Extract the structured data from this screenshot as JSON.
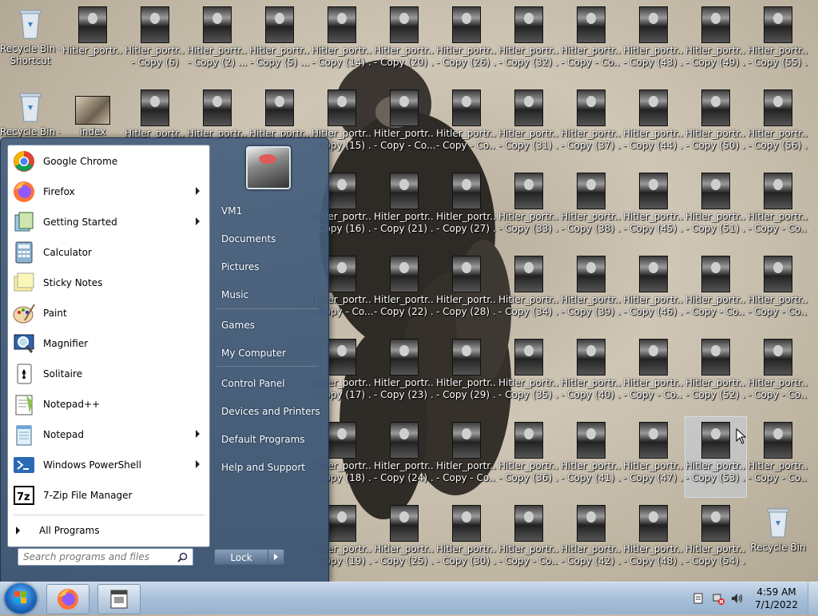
{
  "desktop": {
    "row1": [
      {
        "l1": "Recycle Bin -",
        "l2": "Shortcut",
        "kind": "bin"
      },
      {
        "l1": "Hitler_portr...",
        "l2": "",
        "kind": "photo"
      },
      {
        "l1": "Hitler_portr...",
        "l2": "- Copy (6)",
        "kind": "photo"
      },
      {
        "l1": "Hitler_portr...",
        "l2": "- Copy (2) ...",
        "kind": "photo"
      },
      {
        "l1": "Hitler_portr...",
        "l2": "- Copy (5) ...",
        "kind": "photo"
      },
      {
        "l1": "Hitler_portr...",
        "l2": "- Copy (14) ...",
        "kind": "photo"
      },
      {
        "l1": "Hitler_portr...",
        "l2": "- Copy (20) ...",
        "kind": "photo"
      },
      {
        "l1": "Hitler_portr...",
        "l2": "- Copy (26) ...",
        "kind": "photo"
      },
      {
        "l1": "Hitler_portr...",
        "l2": "- Copy (32) ...",
        "kind": "photo"
      },
      {
        "l1": "Hitler_portr...",
        "l2": "- Copy - Co...",
        "kind": "photo"
      },
      {
        "l1": "Hitler_portr...",
        "l2": "- Copy (43) ...",
        "kind": "photo"
      },
      {
        "l1": "Hitler_portr...",
        "l2": "- Copy (49) ...",
        "kind": "photo"
      },
      {
        "l1": "Hitler_portr...",
        "l2": "- Copy (55) ...",
        "kind": "photo"
      }
    ],
    "row2": [
      {
        "l1": "Recycle Bin -",
        "l2": "",
        "kind": "bin"
      },
      {
        "l1": "index",
        "l2": "",
        "kind": "monkey"
      },
      {
        "l1": "Hitler_portr...",
        "l2": "",
        "kind": "photo"
      },
      {
        "l1": "Hitler_portr...",
        "l2": "",
        "kind": "photo"
      },
      {
        "l1": "Hitler_portr...",
        "l2": "",
        "kind": "photo"
      },
      {
        "l1": "Hitler_portr...",
        "l2": "- Copy (15) ...",
        "kind": "photo"
      },
      {
        "l1": "Hitler_portr...",
        "l2": "- Copy - Co...",
        "kind": "photo"
      },
      {
        "l1": "Hitler_portr...",
        "l2": "- Copy - Co...",
        "kind": "photo"
      },
      {
        "l1": "Hitler_portr...",
        "l2": "- Copy (31) ...",
        "kind": "photo"
      },
      {
        "l1": "Hitler_portr...",
        "l2": "- Copy (37) ...",
        "kind": "photo"
      },
      {
        "l1": "Hitler_portr...",
        "l2": "- Copy (44) ...",
        "kind": "photo"
      },
      {
        "l1": "Hitler_portr...",
        "l2": "- Copy (50) ...",
        "kind": "photo"
      },
      {
        "l1": "Hitler_portr...",
        "l2": "- Copy (56) ...",
        "kind": "photo"
      }
    ],
    "grid": [
      [
        "- Copy (16) ...",
        "- Copy (21) ...",
        "- Copy (27) ...",
        "- Copy (33) ...",
        "- Copy (38) ...",
        "- Copy (45) ...",
        "- Copy (51) ...",
        "- Copy - Co..."
      ],
      [
        "- Copy - Co...",
        "- Copy (22) ...",
        "- Copy (28) ...",
        "- Copy (34) ...",
        "- Copy (39) ...",
        "- Copy (46) ...",
        "- Copy - Co...",
        "- Copy - Co..."
      ],
      [
        "- Copy (17) ...",
        "- Copy (23) ...",
        "- Copy (29) ...",
        "- Copy (35) ...",
        "- Copy (40) ...",
        "- Copy - Co...",
        "- Copy (52) ...",
        "- Copy - Co..."
      ],
      [
        "- Copy (18) ...",
        "- Copy (24) ...",
        "- Copy - Co...",
        "- Copy (36) ...",
        "- Copy (41) ...",
        "- Copy (47) ...",
        "- Copy (53) ...",
        "- Copy - Co..."
      ],
      [
        "- Copy (19) ...",
        "- Copy (25) ...",
        "- Copy (30) ...",
        "- Copy - Co...",
        "- Copy (42) ...",
        "- Copy (48) ...",
        "- Copy (54) ...",
        ""
      ]
    ],
    "grid_label": "Hitler_portr...",
    "recycle_bin_label": "Recycle Bin"
  },
  "start_menu": {
    "programs": [
      {
        "label": "Google Chrome",
        "icon": "chrome-icon",
        "submenu": false
      },
      {
        "label": "Firefox",
        "icon": "firefox-icon",
        "submenu": true
      },
      {
        "label": "Getting Started",
        "icon": "getting-started-icon",
        "submenu": true
      },
      {
        "label": "Calculator",
        "icon": "calculator-icon",
        "submenu": false
      },
      {
        "label": "Sticky Notes",
        "icon": "sticky-notes-icon",
        "submenu": false
      },
      {
        "label": "Paint",
        "icon": "paint-icon",
        "submenu": false
      },
      {
        "label": "Magnifier",
        "icon": "magnifier-icon",
        "submenu": false
      },
      {
        "label": "Solitaire",
        "icon": "solitaire-icon",
        "submenu": false
      },
      {
        "label": "Notepad++",
        "icon": "notepadpp-icon",
        "submenu": false
      },
      {
        "label": "Notepad",
        "icon": "notepad-icon",
        "submenu": true
      },
      {
        "label": "Windows PowerShell",
        "icon": "powershell-icon",
        "submenu": true
      },
      {
        "label": "7-Zip File Manager",
        "icon": "sevenzip-icon",
        "submenu": false
      }
    ],
    "all_programs": "All Programs",
    "search_placeholder": "Search programs and files",
    "right_items": [
      "VM1",
      "Documents",
      "Pictures",
      "Music",
      "Games",
      "My Computer",
      "Control Panel",
      "Devices and Printers",
      "Default Programs",
      "Help and Support"
    ],
    "lock_label": "Lock"
  },
  "taskbar": {
    "time": "4:59 AM",
    "date": "7/1/2022"
  }
}
